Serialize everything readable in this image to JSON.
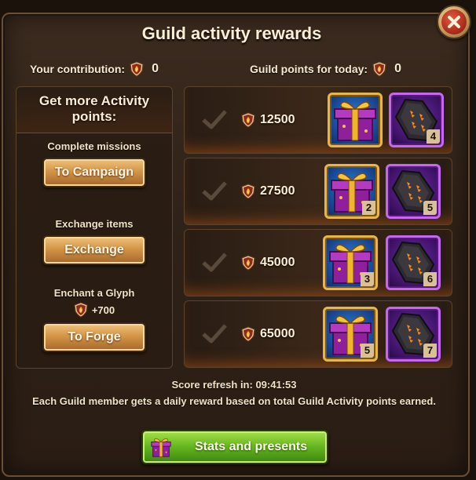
{
  "window": {
    "title": "Guild activity rewards",
    "close_icon": "close-icon"
  },
  "stats": {
    "contribution_label": "Your contribution:",
    "contribution_value": "0",
    "guild_points_label": "Guild points for today:",
    "guild_points_value": "0"
  },
  "left_panel": {
    "heading": "Get more Activity points:",
    "missions_label": "Complete missions",
    "campaign_button": "To Campaign",
    "exchange_label": "Exchange items",
    "exchange_button": "Exchange",
    "glyph_label": "Enchant a Glyph",
    "glyph_bonus": "+700",
    "forge_button": "To Forge"
  },
  "rewards": [
    {
      "points": "12500",
      "gift_qty": "",
      "glyph_qty": "4"
    },
    {
      "points": "27500",
      "gift_qty": "2",
      "glyph_qty": "5"
    },
    {
      "points": "45000",
      "gift_qty": "3",
      "glyph_qty": "6"
    },
    {
      "points": "65000",
      "gift_qty": "5",
      "glyph_qty": "7"
    }
  ],
  "footer": {
    "refresh_text": "Score refresh in: 09:41:53",
    "info_text": "Each Guild member gets a daily reward based on total Guild Activity points earned.",
    "stats_button": "Stats and presents"
  },
  "colors": {
    "gold": "#e8b547",
    "glyph_border": "#c468f0",
    "green_button": "#62b51e",
    "close_red": "#a6281a"
  }
}
